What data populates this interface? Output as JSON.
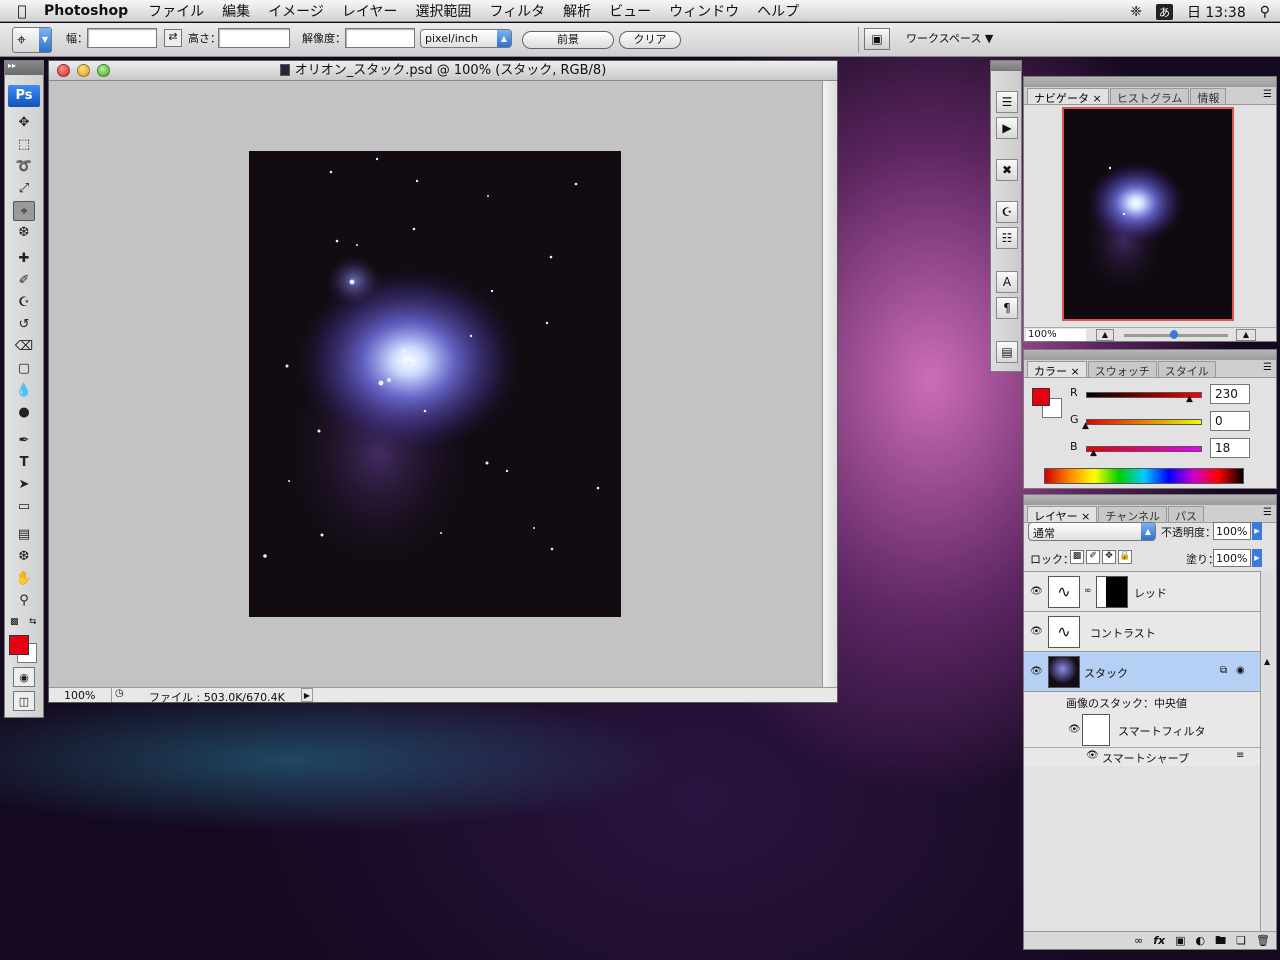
{
  "menubar": {
    "apple": "",
    "app_name": "Photoshop",
    "items": [
      "ファイル",
      "編集",
      "イメージ",
      "レイヤー",
      "選択範囲",
      "フィルタ",
      "解析",
      "ビュー",
      "ウィンドウ",
      "ヘルプ"
    ],
    "ime": "あ",
    "clock": "日 13:38"
  },
  "options": {
    "width_label": "幅：",
    "width_value": "",
    "height_label": "高さ：",
    "height_value": "",
    "resolution_label": "解像度：",
    "resolution_value": "",
    "unit": "pixel/inch",
    "front_button": "前景",
    "clear_button": "クリア",
    "workspace": "ワークスペース ▼"
  },
  "toolbox": {
    "logo": "Ps",
    "tools": [
      "move-icon",
      "marquee-icon",
      "lasso-icon",
      "magic-wand-icon",
      "crop-icon",
      "eyedropper-icon",
      "healing-brush-icon",
      "brush-icon",
      "clone-stamp-icon",
      "history-brush-icon",
      "eraser-icon",
      "gradient-icon",
      "blur-icon",
      "dodge-icon",
      "pen-icon",
      "type-icon",
      "path-select-icon",
      "shape-icon",
      "notes-icon",
      "eyedropper2-icon",
      "hand-icon",
      "zoom-icon"
    ],
    "foreground_color": "#e60012",
    "background_color": "#ffffff"
  },
  "document": {
    "title": "オリオン_スタック.psd @ 100% (スタック, RGB/8)",
    "zoom": "100%",
    "file_info": "ファイル : 503.0K/670.4K"
  },
  "navigator": {
    "tabs": [
      "ナビゲータ",
      "ヒストグラム",
      "情報"
    ],
    "zoom": "100%"
  },
  "color_panel": {
    "tabs": [
      "カラー",
      "スウォッチ",
      "スタイル"
    ],
    "r_label": "R",
    "r_value": "230",
    "g_label": "G",
    "g_value": "0",
    "b_label": "B",
    "b_value": "18",
    "current_color": "#e60012"
  },
  "layers_panel": {
    "tabs": [
      "レイヤー",
      "チャンネル",
      "パス"
    ],
    "blend_mode": "通常",
    "opacity_label": "不透明度：",
    "opacity_value": "100%",
    "lock_label": "ロック：",
    "fill_label": "塗り：",
    "fill_value": "100%",
    "layers": [
      "レッド",
      "コントラスト",
      "スタック"
    ],
    "stack_mode": "画像のスタック：中央値",
    "smart_filter": "スマートフィルタ",
    "smart_sharpen": "スマートシャープ"
  }
}
